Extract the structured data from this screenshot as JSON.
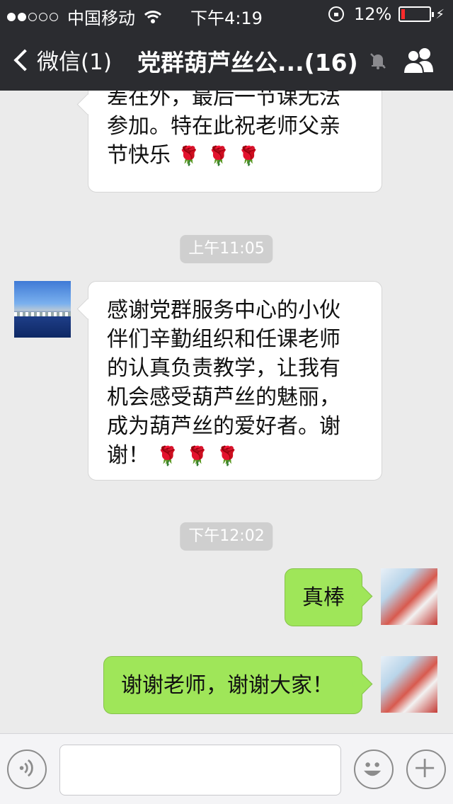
{
  "status_bar": {
    "carrier": "中国移动",
    "time": "下午4:19",
    "battery_percent": "12%",
    "battery_level": 0.12
  },
  "nav": {
    "back_label": "微信(1)",
    "title": "党群葫芦丝公...(16)"
  },
  "messages": [
    {
      "side": "left",
      "lines": [
        "差在外，最后一节课无法",
        "参加。特在此祝老师父亲",
        "节快乐"
      ],
      "emoji": "🌹🌹🌹"
    },
    {
      "type": "timestamp",
      "text": "上午11:05"
    },
    {
      "side": "left",
      "lines": [
        "感谢党群服务中心的小伙",
        "伴们辛勤组织和任课老师",
        "的认真负责教学，让我有",
        "机会感受葫芦丝的魅丽，",
        "成为葫芦丝的爱好者。谢",
        "谢！"
      ],
      "emoji": "🌹🌹🌹"
    },
    {
      "type": "timestamp",
      "text": "下午12:02"
    },
    {
      "side": "right",
      "text": "真棒"
    },
    {
      "side": "right",
      "text": "谢谢老师，谢谢大家！"
    }
  ],
  "colors": {
    "nav_bg": "#2b2c30",
    "chat_bg": "#ebebeb",
    "sent_bubble": "#9fe659",
    "received_bubble": "#ffffff",
    "battery_low": "#ff2b2b"
  },
  "icons": {
    "back": "chevron-left-icon",
    "mute": "mute-bell-icon",
    "group": "group-members-icon",
    "voice": "voice-icon",
    "emoji": "emoji-icon",
    "plus": "plus-icon"
  }
}
